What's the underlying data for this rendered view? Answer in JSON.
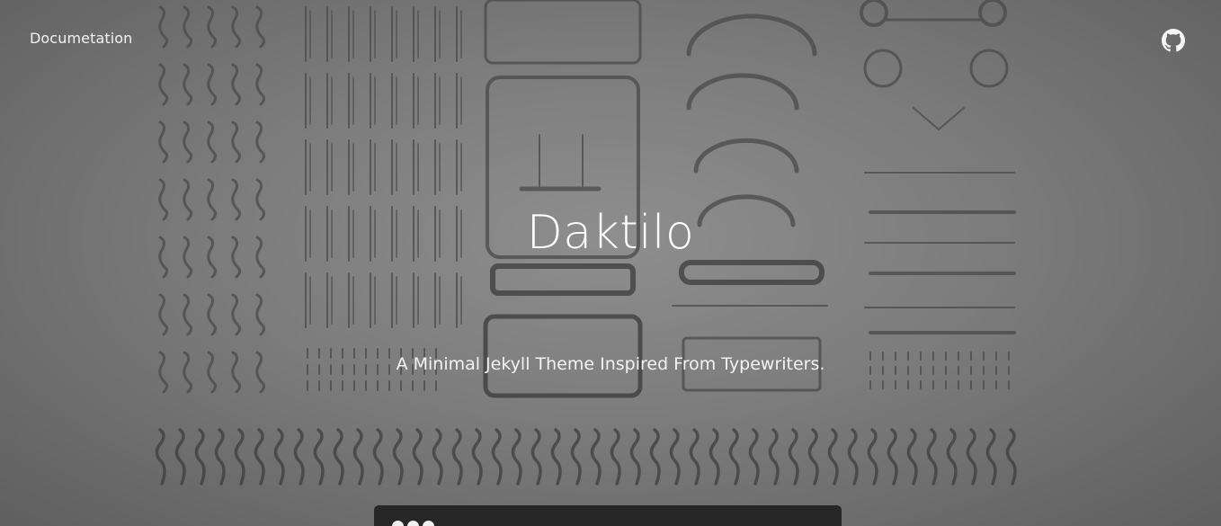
{
  "nav": {
    "doc_label": "Documetation",
    "github_icon": "github-icon"
  },
  "hero": {
    "title": "Daktilo",
    "subtitle": "A Minimal Jekyll Theme Inspired From Typewriters."
  },
  "terminal": {
    "dots": [
      "dot",
      "dot",
      "dot"
    ]
  },
  "colors": {
    "overlay": "#7a7a7a",
    "terminal_bg": "#262626",
    "text": "#ffffff"
  }
}
